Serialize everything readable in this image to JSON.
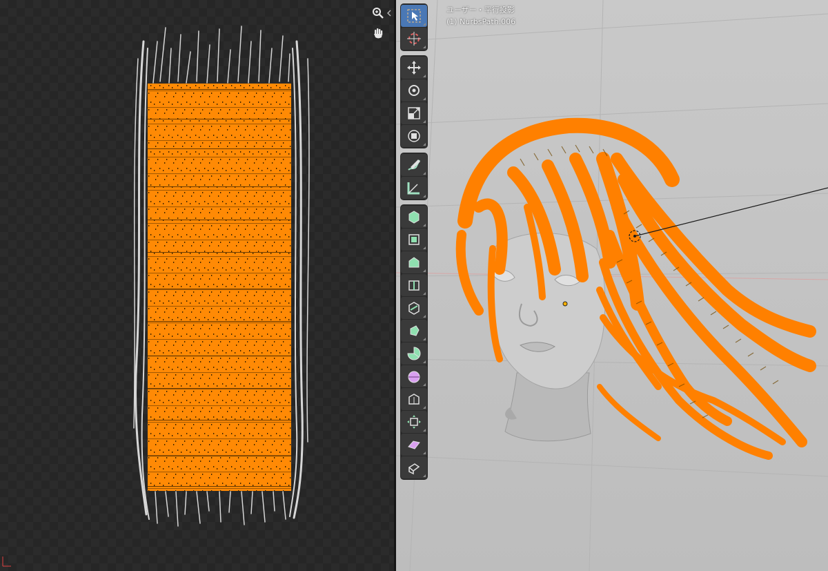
{
  "viewport": {
    "view_label": "ユーザー・平行投影",
    "object_label": "(1) NurbsPath.006"
  },
  "toolbar": {
    "groups": [
      [
        "select-box-icon",
        "cursor-icon"
      ],
      [
        "move-icon",
        "rotate-icon",
        "scale-icon",
        "transform-icon"
      ],
      [
        "annotate-icon",
        "measure-icon"
      ],
      [
        "add-cube-icon",
        "extrude-region-icon",
        "inset-faces-icon",
        "bevel-icon",
        "loop-cut-icon",
        "knife-icon",
        "poly-build-icon",
        "spin-icon",
        "smooth-icon",
        "edge-slide-icon",
        "shrink-fatten-icon",
        "shear-icon",
        "rip-region-icon"
      ]
    ],
    "active": "select-box-icon"
  },
  "colors": {
    "hair_orange": "#ff8000",
    "viewport_bg": "#c3c3c3",
    "uv_bg": "#2b2b2b",
    "active_tool": "#4a78b5"
  },
  "uv_editor": {
    "nav_icons": [
      "zoom-icon",
      "pan-hand-icon"
    ]
  }
}
